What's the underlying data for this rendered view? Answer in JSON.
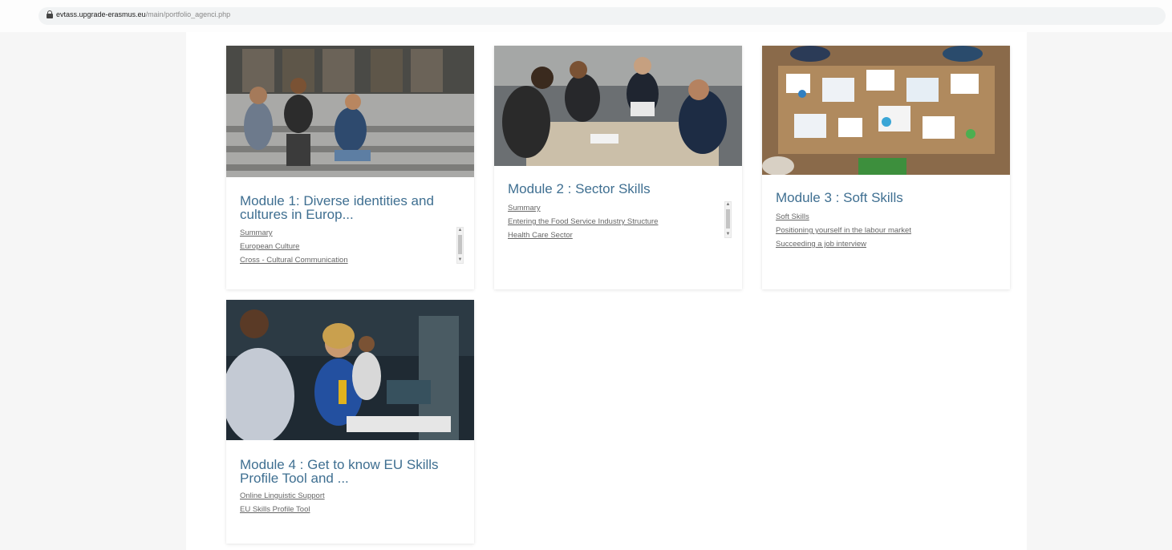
{
  "browser": {
    "url_host": "evtass.upgrade-erasmus.eu",
    "url_path": "/main/portfolio_agenci.php"
  },
  "modules": [
    {
      "title": "Module 1: Diverse identities and cultures in Europ...",
      "links": [
        "Summary",
        "European Culture",
        "Cross - Cultural Communication"
      ]
    },
    {
      "title": "Module 2 : Sector Skills",
      "links": [
        "Summary",
        "Entering the Food Service Industry Structure",
        "Health Care Sector"
      ]
    },
    {
      "title": "Module 3 : Soft Skills",
      "links": [
        "Soft Skills",
        "Positioning yourself in the labour market",
        "Succeeding a job interview"
      ]
    },
    {
      "title": "Module 4 : Get to know EU Skills Profile Tool and ...",
      "links": [
        "Online Linguistic Support",
        "EU Skills Profile Tool"
      ]
    }
  ],
  "colors": {
    "title": "#3f6f91",
    "link": "#666666",
    "page_bg": "#ffffff",
    "outer_bg": "#f6f6f6"
  },
  "icons": {
    "address_bar": "lock-icon",
    "scroll_up": "scroll-up-arrow-icon",
    "scroll_down": "scroll-down-arrow-icon"
  }
}
